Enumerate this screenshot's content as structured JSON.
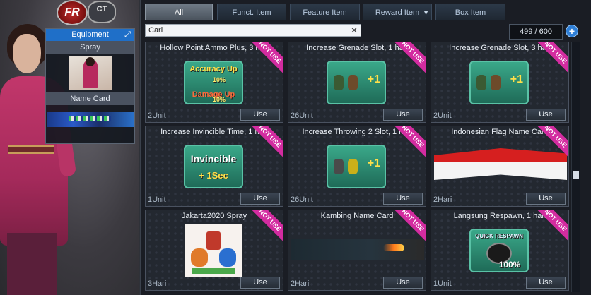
{
  "logo": {
    "left": "FR",
    "right": "CT"
  },
  "equipment": {
    "title": "Equipment",
    "slots": [
      {
        "label": "Spray"
      },
      {
        "label": "Name Card"
      }
    ]
  },
  "tabs": [
    {
      "label": "All",
      "active": true
    },
    {
      "label": "Funct. Item",
      "active": false
    },
    {
      "label": "Feature Item",
      "active": false
    },
    {
      "label": "Reward Item",
      "active": false,
      "dropdown": true
    },
    {
      "label": "Box Item",
      "active": false
    }
  ],
  "search": {
    "value": "Cari"
  },
  "counter": "499 / 600",
  "items": [
    {
      "title": "Hollow Point Ammo Plus, 3 hari",
      "unit": "2Unit",
      "badge": "NOT USE",
      "use": "Use",
      "image_text": [
        "Accuracy Up",
        "Damage Up"
      ],
      "image_numbers": [
        "10%",
        "10%"
      ]
    },
    {
      "title": "Increase Grenade Slot, 1 hari",
      "unit": "26Unit",
      "badge": "NOT USE",
      "use": "Use",
      "plus": "+1"
    },
    {
      "title": "Increase Grenade Slot, 3 hari",
      "unit": "2Unit",
      "badge": "NOT USE",
      "use": "Use",
      "plus": "+1"
    },
    {
      "title": "Increase Invincible Time, 1 hari",
      "unit": "1Unit",
      "badge": "NOT USE",
      "use": "Use",
      "image_text": [
        "Invincible",
        "+ 1Sec"
      ]
    },
    {
      "title": "Increase Throwing 2 Slot, 1 hari",
      "unit": "26Unit",
      "badge": "NOT USE",
      "use": "Use",
      "plus": "+1"
    },
    {
      "title": "Indonesian Flag Name Card",
      "unit": "2Hari",
      "badge": "NOT USE",
      "use": "Use"
    },
    {
      "title": "Jakarta2020 Spray",
      "unit": "3Hari",
      "badge": "NOT USE",
      "use": "Use"
    },
    {
      "title": "Kambing Name Card",
      "unit": "2Hari",
      "badge": "NOT USE",
      "use": "Use"
    },
    {
      "title": "Langsung Respawn, 1 hari",
      "unit": "1Unit",
      "badge": "NOT USE",
      "use": "Use",
      "image_text": [
        "QUICK RESPAWN",
        "100%"
      ]
    }
  ],
  "colors": {
    "accent_blue": "#1f6fc8",
    "not_use_badge": "#d32ca0",
    "panel_bg": "#1a1d24"
  }
}
